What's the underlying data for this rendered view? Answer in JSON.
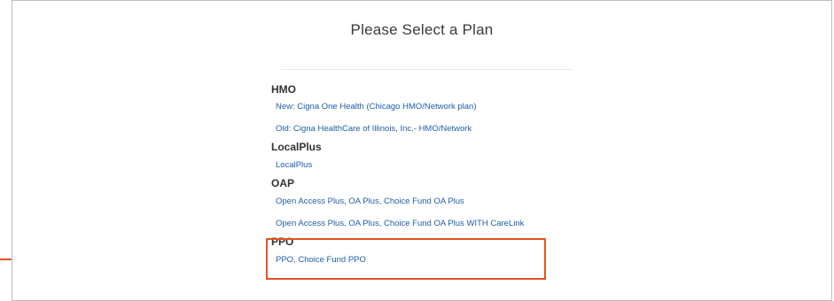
{
  "page": {
    "title": "Please Select a Plan"
  },
  "plans": {
    "groups": [
      {
        "name": "HMO",
        "items": [
          "New: Cigna One Health (Chicago HMO/Network plan)",
          "Old: Cigna HealthCare of Illinois, Inc.- HMO/Network"
        ]
      },
      {
        "name": "LocalPlus",
        "items": [
          "LocalPlus"
        ]
      },
      {
        "name": "OAP",
        "items": [
          "Open Access Plus, OA Plus, Choice Fund OA Plus",
          "Open Access Plus, OA Plus, Choice Fund OA Plus WITH CareLink"
        ]
      },
      {
        "name": "PPO",
        "items": [
          "PPO, Choice Fund PPO"
        ]
      }
    ]
  },
  "colors": {
    "highlight": "#e2541d",
    "link": "#1f5fa8"
  }
}
